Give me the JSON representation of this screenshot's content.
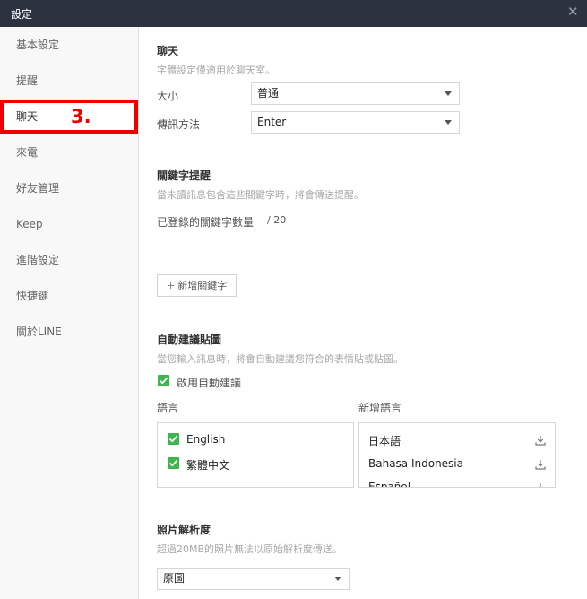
{
  "window": {
    "title": "設定"
  },
  "sidebar": {
    "items": [
      {
        "label": "基本設定"
      },
      {
        "label": "提醒"
      },
      {
        "label": "聊天"
      },
      {
        "label": "來電"
      },
      {
        "label": "好友管理"
      },
      {
        "label": "Keep"
      },
      {
        "label": "進階設定"
      },
      {
        "label": "快捷鍵"
      },
      {
        "label": "關於LINE"
      }
    ],
    "annotation": "3."
  },
  "chat": {
    "heading": "聊天",
    "desc": "字體設定僅適用於聊天室。",
    "size_label": "大小",
    "size_value": "普通",
    "send_label": "傳訊方法",
    "send_value": "Enter"
  },
  "keyword": {
    "heading": "關鍵字提醒",
    "desc": "當未讀訊息包含這些關鍵字時，將會傳送提醒。",
    "count_label": "已登錄的關鍵字數量",
    "count_value": "/ 20",
    "add_button": "新增關鍵字"
  },
  "suggest": {
    "heading": "自動建議貼圖",
    "desc": "當您輸入訊息時，將會自動建議您符合的表情貼或貼圖。",
    "enable_label": "啟用自動建議",
    "languages_label": "語言",
    "add_languages_label": "新增語言",
    "languages": [
      "English",
      "繁體中文"
    ],
    "available": [
      "日本語",
      "Bahasa Indonesia",
      "Español"
    ]
  },
  "photo": {
    "heading": "照片解析度",
    "desc": "超過20MB的照片無法以原始解析度傳送。",
    "value": "原圖"
  },
  "colors": {
    "titlebar": "#2b3240",
    "check": "#3cb64d",
    "annotation": "#ee0000"
  }
}
